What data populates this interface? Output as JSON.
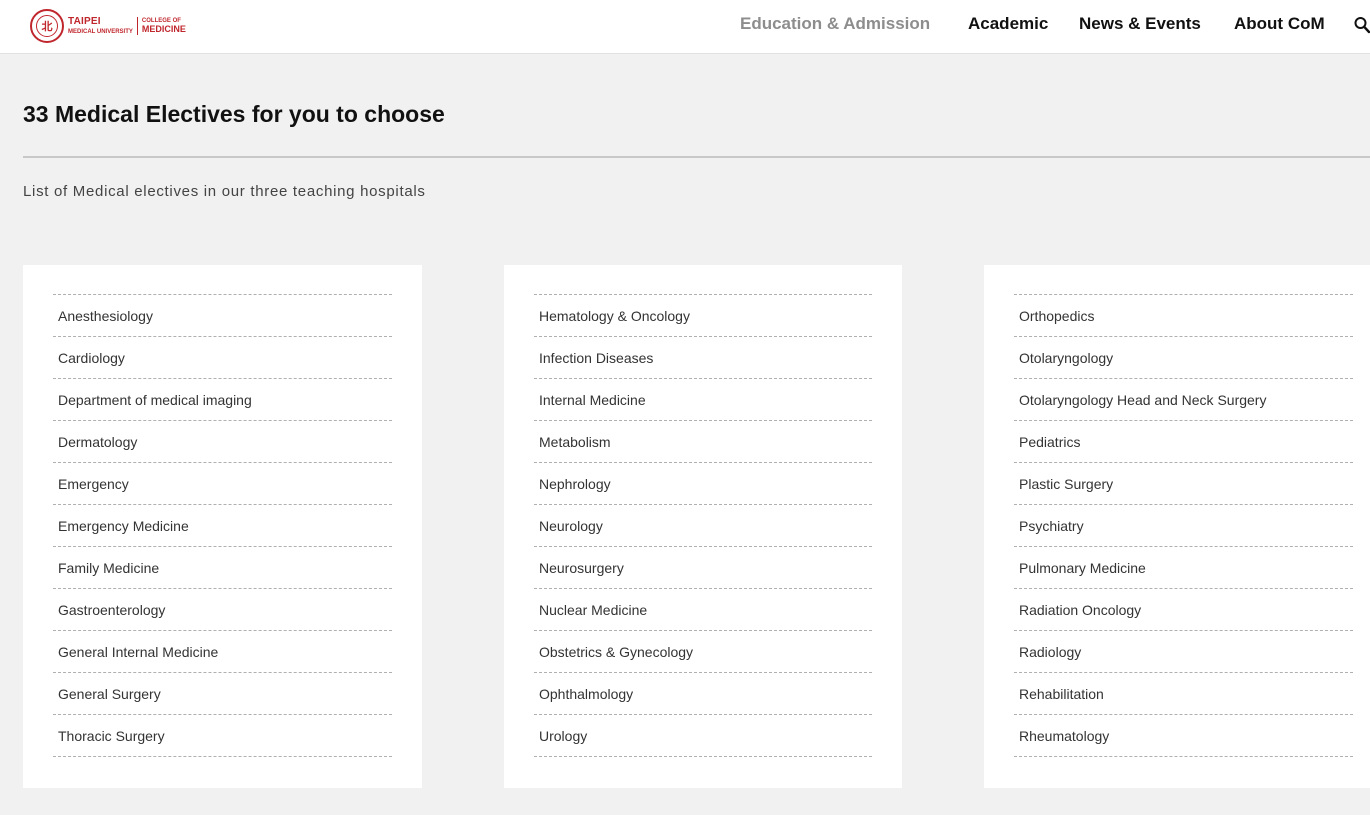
{
  "header": {
    "logo": {
      "seal_glyph": "北",
      "university_line1": "TAIPEI",
      "university_line2": "MEDICAL UNIVERSITY",
      "college_line1": "COLLEGE OF",
      "college_line2": "MEDICINE",
      "brand_color": "#c0272d"
    },
    "nav": [
      "Education & Admission",
      "Academic",
      "News & Events",
      "About CoM"
    ],
    "search_icon": "search-icon"
  },
  "page": {
    "title": "33 Medical Electives for you to choose",
    "subtitle": "List of Medical electives in our three teaching hospitals"
  },
  "columns": [
    [
      "Anesthesiology",
      "Cardiology",
      "Department of medical imaging",
      "Dermatology",
      "Emergency",
      "Emergency Medicine",
      "Family Medicine",
      "Gastroenterology",
      "General Internal Medicine",
      "General Surgery",
      "Thoracic Surgery"
    ],
    [
      "Hematology & Oncology",
      "Infection Diseases",
      "Internal Medicine",
      "Metabolism",
      "Nephrology",
      "Neurology",
      "Neurosurgery",
      "Nuclear Medicine",
      "Obstetrics & Gynecology",
      "Ophthalmology",
      "Urology"
    ],
    [
      "Orthopedics",
      "Otolaryngology",
      "Otolaryngology Head and Neck Surgery",
      "Pediatrics",
      "Plastic Surgery",
      "Psychiatry",
      "Pulmonary Medicine",
      "Radiation Oncology",
      "Radiology",
      "Rehabilitation",
      "Rheumatology"
    ]
  ]
}
